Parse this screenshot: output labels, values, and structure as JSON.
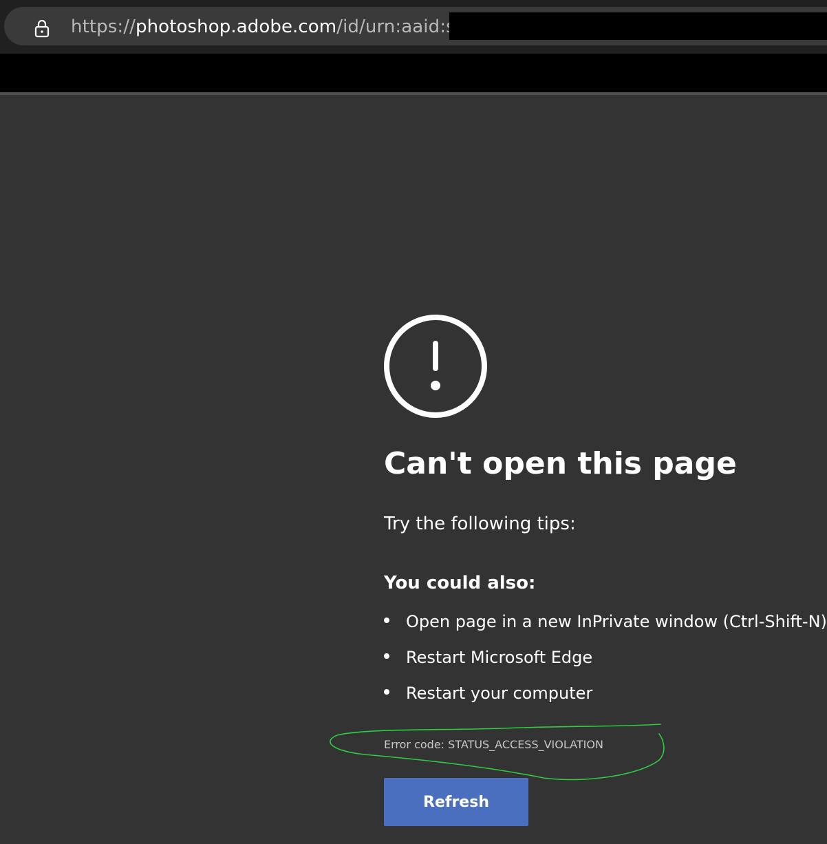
{
  "browser": {
    "address_bar": {
      "scheme": "https://",
      "host": "photoshop.adobe.com",
      "path": "/id/urn:aaid:sc:",
      "lock_icon": "lock-icon"
    }
  },
  "error_page": {
    "icon": "exclamation-circle-icon",
    "title": "Can't open this page",
    "tips_intro": "Try the following tips:",
    "also_heading": "You could also:",
    "tips": [
      "Open page in a new InPrivate window (Ctrl-Shift-N)",
      "Restart Microsoft Edge",
      "Restart your computer"
    ],
    "error_code": "Error code: STATUS_ACCESS_VIOLATION",
    "refresh_label": "Refresh",
    "refresh_color": "#4a6fbf",
    "annotation_color": "#2ecc40"
  }
}
